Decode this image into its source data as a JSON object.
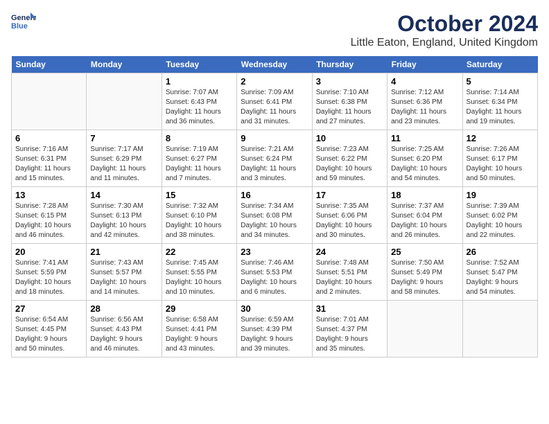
{
  "app": {
    "name": "GeneralBlue",
    "logo_line1": "General",
    "logo_line2": "Blue"
  },
  "calendar": {
    "month_year": "October 2024",
    "location": "Little Eaton, England, United Kingdom",
    "days_of_week": [
      "Sunday",
      "Monday",
      "Tuesday",
      "Wednesday",
      "Thursday",
      "Friday",
      "Saturday"
    ],
    "weeks": [
      [
        {
          "date": "",
          "lines": []
        },
        {
          "date": "",
          "lines": []
        },
        {
          "date": "1",
          "lines": [
            "Sunrise: 7:07 AM",
            "Sunset: 6:43 PM",
            "Daylight: 11 hours",
            "and 36 minutes."
          ]
        },
        {
          "date": "2",
          "lines": [
            "Sunrise: 7:09 AM",
            "Sunset: 6:41 PM",
            "Daylight: 11 hours",
            "and 31 minutes."
          ]
        },
        {
          "date": "3",
          "lines": [
            "Sunrise: 7:10 AM",
            "Sunset: 6:38 PM",
            "Daylight: 11 hours",
            "and 27 minutes."
          ]
        },
        {
          "date": "4",
          "lines": [
            "Sunrise: 7:12 AM",
            "Sunset: 6:36 PM",
            "Daylight: 11 hours",
            "and 23 minutes."
          ]
        },
        {
          "date": "5",
          "lines": [
            "Sunrise: 7:14 AM",
            "Sunset: 6:34 PM",
            "Daylight: 11 hours",
            "and 19 minutes."
          ]
        }
      ],
      [
        {
          "date": "6",
          "lines": [
            "Sunrise: 7:16 AM",
            "Sunset: 6:31 PM",
            "Daylight: 11 hours",
            "and 15 minutes."
          ]
        },
        {
          "date": "7",
          "lines": [
            "Sunrise: 7:17 AM",
            "Sunset: 6:29 PM",
            "Daylight: 11 hours",
            "and 11 minutes."
          ]
        },
        {
          "date": "8",
          "lines": [
            "Sunrise: 7:19 AM",
            "Sunset: 6:27 PM",
            "Daylight: 11 hours",
            "and 7 minutes."
          ]
        },
        {
          "date": "9",
          "lines": [
            "Sunrise: 7:21 AM",
            "Sunset: 6:24 PM",
            "Daylight: 11 hours",
            "and 3 minutes."
          ]
        },
        {
          "date": "10",
          "lines": [
            "Sunrise: 7:23 AM",
            "Sunset: 6:22 PM",
            "Daylight: 10 hours",
            "and 59 minutes."
          ]
        },
        {
          "date": "11",
          "lines": [
            "Sunrise: 7:25 AM",
            "Sunset: 6:20 PM",
            "Daylight: 10 hours",
            "and 54 minutes."
          ]
        },
        {
          "date": "12",
          "lines": [
            "Sunrise: 7:26 AM",
            "Sunset: 6:17 PM",
            "Daylight: 10 hours",
            "and 50 minutes."
          ]
        }
      ],
      [
        {
          "date": "13",
          "lines": [
            "Sunrise: 7:28 AM",
            "Sunset: 6:15 PM",
            "Daylight: 10 hours",
            "and 46 minutes."
          ]
        },
        {
          "date": "14",
          "lines": [
            "Sunrise: 7:30 AM",
            "Sunset: 6:13 PM",
            "Daylight: 10 hours",
            "and 42 minutes."
          ]
        },
        {
          "date": "15",
          "lines": [
            "Sunrise: 7:32 AM",
            "Sunset: 6:10 PM",
            "Daylight: 10 hours",
            "and 38 minutes."
          ]
        },
        {
          "date": "16",
          "lines": [
            "Sunrise: 7:34 AM",
            "Sunset: 6:08 PM",
            "Daylight: 10 hours",
            "and 34 minutes."
          ]
        },
        {
          "date": "17",
          "lines": [
            "Sunrise: 7:35 AM",
            "Sunset: 6:06 PM",
            "Daylight: 10 hours",
            "and 30 minutes."
          ]
        },
        {
          "date": "18",
          "lines": [
            "Sunrise: 7:37 AM",
            "Sunset: 6:04 PM",
            "Daylight: 10 hours",
            "and 26 minutes."
          ]
        },
        {
          "date": "19",
          "lines": [
            "Sunrise: 7:39 AM",
            "Sunset: 6:02 PM",
            "Daylight: 10 hours",
            "and 22 minutes."
          ]
        }
      ],
      [
        {
          "date": "20",
          "lines": [
            "Sunrise: 7:41 AM",
            "Sunset: 5:59 PM",
            "Daylight: 10 hours",
            "and 18 minutes."
          ]
        },
        {
          "date": "21",
          "lines": [
            "Sunrise: 7:43 AM",
            "Sunset: 5:57 PM",
            "Daylight: 10 hours",
            "and 14 minutes."
          ]
        },
        {
          "date": "22",
          "lines": [
            "Sunrise: 7:45 AM",
            "Sunset: 5:55 PM",
            "Daylight: 10 hours",
            "and 10 minutes."
          ]
        },
        {
          "date": "23",
          "lines": [
            "Sunrise: 7:46 AM",
            "Sunset: 5:53 PM",
            "Daylight: 10 hours",
            "and 6 minutes."
          ]
        },
        {
          "date": "24",
          "lines": [
            "Sunrise: 7:48 AM",
            "Sunset: 5:51 PM",
            "Daylight: 10 hours",
            "and 2 minutes."
          ]
        },
        {
          "date": "25",
          "lines": [
            "Sunrise: 7:50 AM",
            "Sunset: 5:49 PM",
            "Daylight: 9 hours",
            "and 58 minutes."
          ]
        },
        {
          "date": "26",
          "lines": [
            "Sunrise: 7:52 AM",
            "Sunset: 5:47 PM",
            "Daylight: 9 hours",
            "and 54 minutes."
          ]
        }
      ],
      [
        {
          "date": "27",
          "lines": [
            "Sunrise: 6:54 AM",
            "Sunset: 4:45 PM",
            "Daylight: 9 hours",
            "and 50 minutes."
          ]
        },
        {
          "date": "28",
          "lines": [
            "Sunrise: 6:56 AM",
            "Sunset: 4:43 PM",
            "Daylight: 9 hours",
            "and 46 minutes."
          ]
        },
        {
          "date": "29",
          "lines": [
            "Sunrise: 6:58 AM",
            "Sunset: 4:41 PM",
            "Daylight: 9 hours",
            "and 43 minutes."
          ]
        },
        {
          "date": "30",
          "lines": [
            "Sunrise: 6:59 AM",
            "Sunset: 4:39 PM",
            "Daylight: 9 hours",
            "and 39 minutes."
          ]
        },
        {
          "date": "31",
          "lines": [
            "Sunrise: 7:01 AM",
            "Sunset: 4:37 PM",
            "Daylight: 9 hours",
            "and 35 minutes."
          ]
        },
        {
          "date": "",
          "lines": []
        },
        {
          "date": "",
          "lines": []
        }
      ]
    ]
  }
}
